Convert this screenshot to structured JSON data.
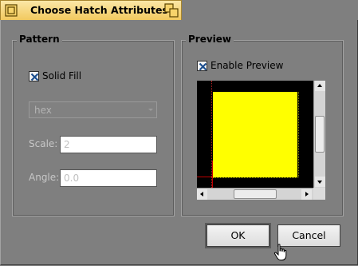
{
  "window": {
    "title": "Choose Hatch Attributes"
  },
  "pattern": {
    "legend": "Pattern",
    "solid_fill_label": "Solid Fill",
    "solid_fill_checked": true,
    "pattern_value": "hex",
    "scale_label": "Scale:",
    "scale_value": "2",
    "angle_label": "Angle:",
    "angle_value": "0.0"
  },
  "preview": {
    "legend": "Preview",
    "enable_label": "Enable Preview",
    "enable_checked": true,
    "fill_color": "#ffff00"
  },
  "buttons": {
    "ok_label": "OK",
    "cancel_label": "Cancel"
  }
}
